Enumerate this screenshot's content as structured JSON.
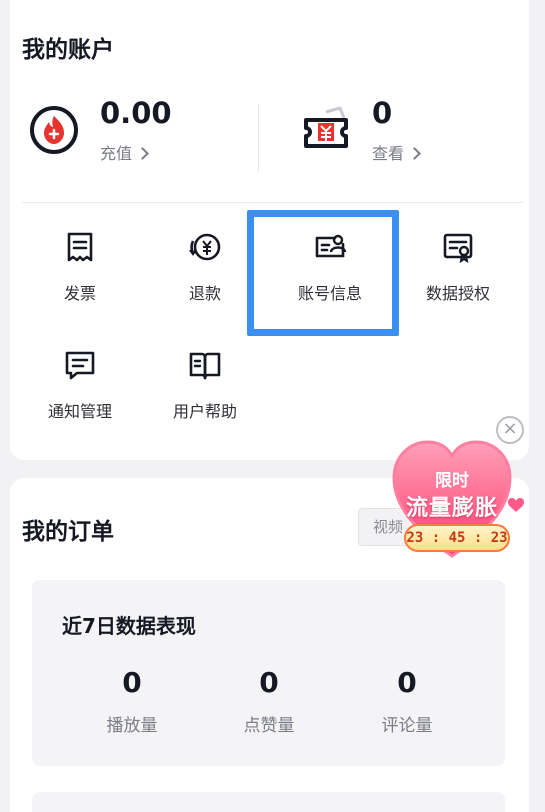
{
  "account": {
    "title": "我的账户",
    "balance": {
      "value": "0.00",
      "link_label": "充值"
    },
    "tickets": {
      "value": "0",
      "link_label": "查看"
    },
    "grid": [
      {
        "label": "发票",
        "icon": "invoice-icon"
      },
      {
        "label": "退款",
        "icon": "refund-icon"
      },
      {
        "label": "账号信息",
        "icon": "account-info-icon"
      },
      {
        "label": "数据授权",
        "icon": "data-authorization-icon"
      },
      {
        "label": "通知管理",
        "icon": "notification-icon"
      },
      {
        "label": "用户帮助",
        "icon": "help-book-icon"
      }
    ]
  },
  "orders": {
    "title": "我的订单",
    "tab_partial": "视频",
    "stats": {
      "title": "近7日数据表现",
      "items": [
        {
          "value": "0",
          "label": "播放量"
        },
        {
          "value": "0",
          "label": "点赞量"
        },
        {
          "value": "0",
          "label": "评论量"
        }
      ]
    }
  },
  "promo": {
    "line1": "限时",
    "line2": "流量膨胀",
    "timer": "23 : 45 : 23",
    "close": "×"
  },
  "colors": {
    "highlight": "#3b8ff0",
    "coin_red": "#e8342e",
    "promo_pink": "#ff5a8a"
  }
}
